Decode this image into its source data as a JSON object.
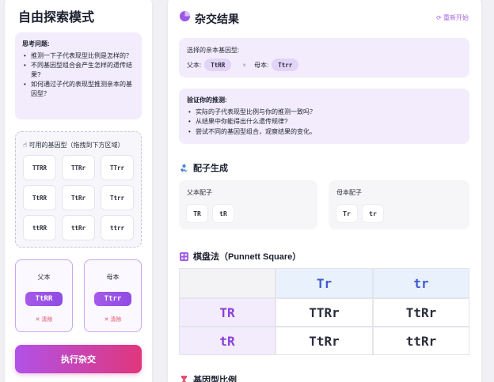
{
  "left": {
    "title": "自由探索模式",
    "hint": {
      "title": "思考问题:",
      "items": [
        "推测一下子代表现型比例是怎样的？",
        "不同基因型组合会产生怎样的遗传结果?",
        "如何通过子代的表现型推测亲本的基因型？"
      ]
    },
    "genes": {
      "title": "可用的基因型（拖拽到下方区域）",
      "tiles": [
        "TTRR",
        "TTRr",
        "TTrr",
        "TtRR",
        "TtRr",
        "Ttrr",
        "ttRR",
        "ttRr",
        "ttrr"
      ]
    },
    "father": {
      "label": "父本",
      "gene": "TtRR",
      "clear": "✕ 清除"
    },
    "mother": {
      "label": "母本",
      "gene": "Ttrr",
      "clear": "✕ 清除"
    },
    "run_button": "执行杂交"
  },
  "right": {
    "title": "杂交结果",
    "reset": "重新开始",
    "selected": {
      "title": "选择的亲本基因型:",
      "father_label": "父本:",
      "father_gene": "TtRR",
      "times": "×",
      "mother_label": "母本:",
      "mother_gene": "Ttrr"
    },
    "verify": {
      "title": "验证你的推测:",
      "items": [
        "实际的子代表现型比例与你的推测一致吗？",
        "从结果中你能得出什么遗传规律?",
        "尝试不同的基因型组合，观察结果的变化。"
      ]
    },
    "gametes": {
      "title": "配子生成",
      "father_label": "父本配子",
      "father": [
        "TR",
        "tR"
      ],
      "mother_label": "母本配子",
      "mother": [
        "Tr",
        "tr"
      ]
    },
    "punnett": {
      "title": "棋盘法（Punnett Square）",
      "col_headers": [
        "Tr",
        "tr"
      ],
      "rows": [
        {
          "header": "TR",
          "cells": [
            "TTRr",
            "TtRr"
          ]
        },
        {
          "header": "tR",
          "cells": [
            "TtRr",
            "ttRr"
          ]
        }
      ]
    },
    "ratio": {
      "title": "基因型比例"
    }
  },
  "colors": {
    "accent": "#9b59e6",
    "pink": "#e0367c",
    "light_purple": "#f2ecfc",
    "header_blue": "#e9f1fd",
    "blue_text": "#3f5bd0"
  }
}
